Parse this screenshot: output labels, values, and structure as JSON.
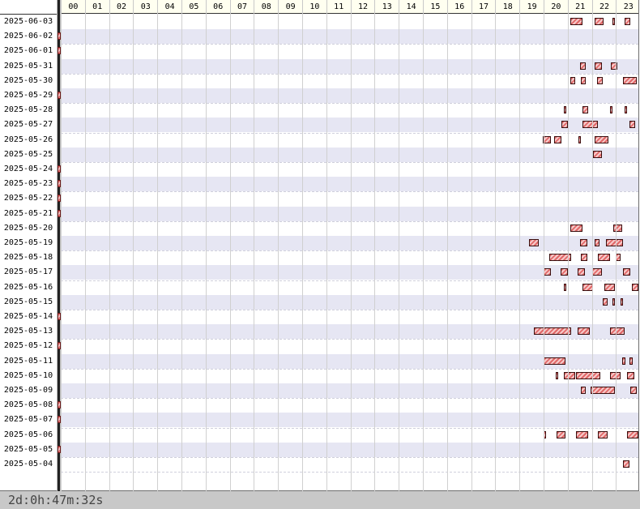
{
  "hours": [
    "00",
    "01",
    "02",
    "03",
    "04",
    "05",
    "06",
    "07",
    "08",
    "09",
    "10",
    "11",
    "12",
    "13",
    "14",
    "15",
    "16",
    "17",
    "18",
    "19",
    "20",
    "21",
    "22",
    "23"
  ],
  "rows": [
    {
      "date": "2025-06-03",
      "bars": [
        [
          21.1,
          21.6
        ],
        [
          22.1,
          22.5
        ],
        [
          22.85,
          22.95
        ],
        [
          23.35,
          23.6
        ]
      ]
    },
    {
      "date": "2025-06-02",
      "bars": [],
      "carry": true
    },
    {
      "date": "2025-06-01",
      "bars": [],
      "carry": true
    },
    {
      "date": "2025-05-31",
      "bars": [
        [
          21.5,
          21.75
        ],
        [
          22.1,
          22.4
        ],
        [
          22.8,
          23.05
        ]
      ]
    },
    {
      "date": "2025-05-30",
      "bars": [
        [
          21.1,
          21.3
        ],
        [
          21.55,
          21.75
        ],
        [
          22.2,
          22.45
        ],
        [
          23.3,
          23.85
        ]
      ]
    },
    {
      "date": "2025-05-29",
      "bars": [],
      "carry": true
    },
    {
      "date": "2025-05-28",
      "bars": [
        [
          20.85,
          20.95
        ],
        [
          21.6,
          21.85
        ],
        [
          22.75,
          22.85
        ],
        [
          23.35,
          23.45
        ]
      ]
    },
    {
      "date": "2025-05-27",
      "bars": [
        [
          20.75,
          21.0
        ],
        [
          21.6,
          22.25
        ],
        [
          23.55,
          23.8
        ]
      ]
    },
    {
      "date": "2025-05-26",
      "bars": [
        [
          19.95,
          20.3
        ],
        [
          20.45,
          20.75
        ],
        [
          21.45,
          21.55
        ],
        [
          22.1,
          22.7
        ]
      ]
    },
    {
      "date": "2025-05-25",
      "bars": [
        [
          22.05,
          22.4
        ]
      ]
    },
    {
      "date": "2025-05-24",
      "bars": [],
      "carry": true
    },
    {
      "date": "2025-05-23",
      "bars": [],
      "carry": true
    },
    {
      "date": "2025-05-22",
      "bars": [],
      "carry": true
    },
    {
      "date": "2025-05-21",
      "bars": [],
      "carry": true
    },
    {
      "date": "2025-05-20",
      "bars": [
        [
          21.1,
          21.6
        ],
        [
          22.9,
          23.25
        ]
      ]
    },
    {
      "date": "2025-05-19",
      "bars": [
        [
          19.4,
          19.8
        ],
        [
          21.5,
          21.8
        ],
        [
          22.1,
          22.3
        ],
        [
          22.6,
          23.3
        ]
      ]
    },
    {
      "date": "2025-05-18",
      "bars": [
        [
          20.25,
          21.15
        ],
        [
          21.55,
          21.8
        ],
        [
          22.25,
          22.75
        ],
        [
          23.0,
          23.2
        ]
      ]
    },
    {
      "date": "2025-05-17",
      "bars": [
        [
          20.0,
          20.3
        ],
        [
          20.7,
          21.0
        ],
        [
          21.4,
          21.7
        ],
        [
          22.0,
          22.4
        ],
        [
          23.3,
          23.6
        ]
      ]
    },
    {
      "date": "2025-05-16",
      "bars": [
        [
          20.85,
          20.95
        ],
        [
          21.6,
          22.05
        ],
        [
          22.5,
          22.95
        ],
        [
          23.65,
          24.0
        ]
      ]
    },
    {
      "date": "2025-05-15",
      "bars": [
        [
          22.45,
          22.65
        ],
        [
          22.85,
          22.95
        ],
        [
          23.2,
          23.3
        ]
      ]
    },
    {
      "date": "2025-05-14",
      "bars": [],
      "carry": true
    },
    {
      "date": "2025-05-13",
      "bars": [
        [
          19.6,
          21.15
        ],
        [
          21.4,
          21.9
        ],
        [
          22.75,
          23.35
        ]
      ]
    },
    {
      "date": "2025-05-12",
      "bars": [],
      "carry": true
    },
    {
      "date": "2025-05-11",
      "bars": [
        [
          20.0,
          20.9
        ],
        [
          23.25,
          23.4
        ],
        [
          23.55,
          23.7
        ]
      ]
    },
    {
      "date": "2025-05-10",
      "bars": [
        [
          20.5,
          20.6
        ],
        [
          20.85,
          21.3
        ],
        [
          21.35,
          22.35
        ],
        [
          22.75,
          23.2
        ],
        [
          23.45,
          23.75
        ]
      ]
    },
    {
      "date": "2025-05-09",
      "bars": [
        [
          21.55,
          21.75
        ],
        [
          21.95,
          22.95
        ],
        [
          23.6,
          23.85
        ]
      ]
    },
    {
      "date": "2025-05-08",
      "bars": [],
      "carry": true
    },
    {
      "date": "2025-05-07",
      "bars": [],
      "carry": true
    },
    {
      "date": "2025-05-06",
      "bars": [
        [
          20.0,
          20.1
        ],
        [
          20.55,
          20.9
        ],
        [
          21.35,
          21.85
        ],
        [
          22.25,
          22.65
        ],
        [
          23.45,
          23.95
        ]
      ]
    },
    {
      "date": "2025-05-05",
      "bars": [],
      "carry": true
    },
    {
      "date": "2025-05-04",
      "bars": [
        [
          23.3,
          23.55
        ]
      ]
    }
  ],
  "footer": {
    "total": "2d:0h:47m:32s"
  }
}
